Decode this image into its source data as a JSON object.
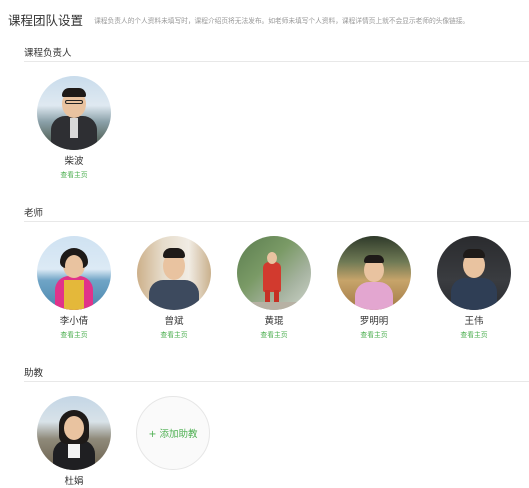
{
  "header": {
    "title": "课程团队设置",
    "hint": "课程负责人的个人资料未填写时，课程介绍页将无法发布。如老师未填写个人资料，课程详情页上就不会显示老师的头像链接。"
  },
  "sections": {
    "leader": {
      "title": "课程负责人"
    },
    "teachers": {
      "title": "老师"
    },
    "assistants": {
      "title": "助教"
    }
  },
  "leader": {
    "name": "柴波",
    "link": "查看主页"
  },
  "teachers": [
    {
      "name": "李小倩",
      "link": "查看主页"
    },
    {
      "name": "曾斌",
      "link": "查看主页"
    },
    {
      "name": "黄琨",
      "link": "查看主页"
    },
    {
      "name": "罗明明",
      "link": "查看主页"
    },
    {
      "name": "王伟",
      "link": "查看主页"
    }
  ],
  "assistants": [
    {
      "name": "杜娟"
    }
  ],
  "add_assistant": {
    "label": "+ 添加助教"
  },
  "colors": {
    "link_green": "#4caf50",
    "divider": "#e8e8e8"
  }
}
